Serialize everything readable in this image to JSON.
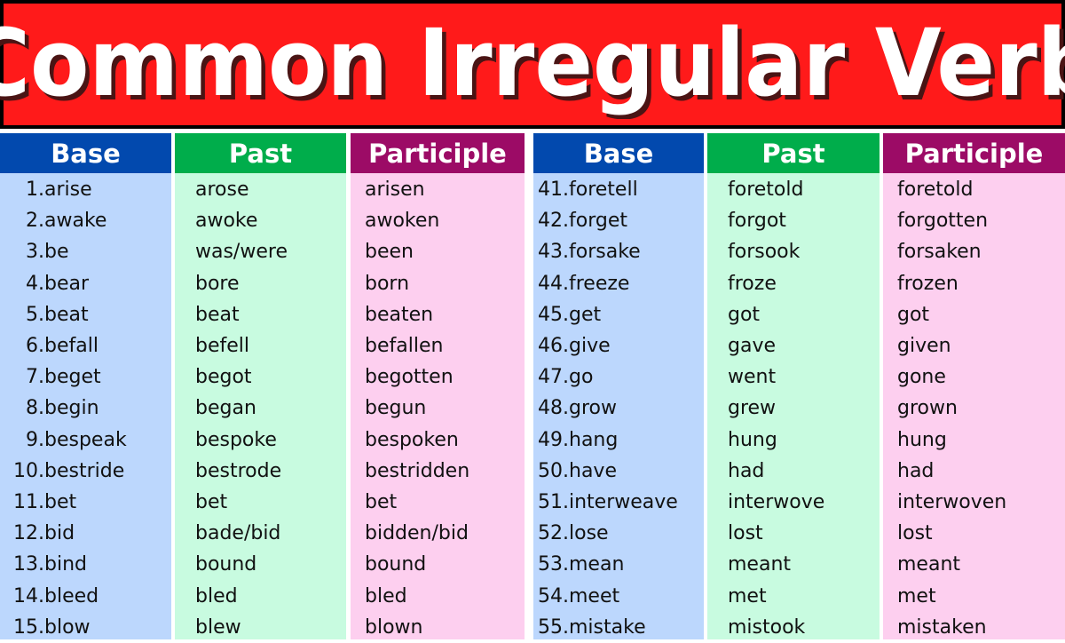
{
  "title": "Common Irregular Verb",
  "colors": {
    "title_bg": "#ff1a1a",
    "title_border": "#000000",
    "base_header": "#0249ae",
    "base_body": "#bcd7fd",
    "past_header": "#00ad4b",
    "past_body": "#c8fbe0",
    "participle_header": "#9c0b66",
    "participle_body": "#fdcfef"
  },
  "panels": [
    {
      "headers": {
        "base": "Base",
        "past": "Past",
        "participle": "Participle"
      },
      "rows": [
        {
          "num": "1.",
          "base": "arise",
          "past": "arose",
          "participle": "arisen"
        },
        {
          "num": "2.",
          "base": "awake",
          "past": "awoke",
          "participle": "awoken"
        },
        {
          "num": "3.",
          "base": "be",
          "past": "was/were",
          "participle": "been"
        },
        {
          "num": "4.",
          "base": "bear",
          "past": "bore",
          "participle": "born"
        },
        {
          "num": "5.",
          "base": "beat",
          "past": "beat",
          "participle": "beaten"
        },
        {
          "num": "6.",
          "base": "befall",
          "past": "befell",
          "participle": "befallen"
        },
        {
          "num": "7.",
          "base": "beget",
          "past": "begot",
          "participle": "begotten"
        },
        {
          "num": "8.",
          "base": "begin",
          "past": "began",
          "participle": "begun"
        },
        {
          "num": "9.",
          "base": "bespeak",
          "past": "bespoke",
          "participle": "bespoken"
        },
        {
          "num": "10.",
          "base": "bestride",
          "past": "bestrode",
          "participle": "bestridden"
        },
        {
          "num": "11.",
          "base": "bet",
          "past": "bet",
          "participle": "bet"
        },
        {
          "num": "12.",
          "base": "bid",
          "past": "bade/bid",
          "participle": "bidden/bid"
        },
        {
          "num": "13.",
          "base": "bind",
          "past": "bound",
          "participle": "bound"
        },
        {
          "num": "14.",
          "base": "bleed",
          "past": "bled",
          "participle": "bled"
        },
        {
          "num": "15.",
          "base": "blow",
          "past": "blew",
          "participle": "blown"
        }
      ]
    },
    {
      "headers": {
        "base": "Base",
        "past": "Past",
        "participle": "Participle"
      },
      "rows": [
        {
          "num": "41.",
          "base": "foretell",
          "past": "foretold",
          "participle": "foretold"
        },
        {
          "num": "42.",
          "base": "forget",
          "past": "forgot",
          "participle": "forgotten"
        },
        {
          "num": "43.",
          "base": "forsake",
          "past": "forsook",
          "participle": "forsaken"
        },
        {
          "num": "44.",
          "base": "freeze",
          "past": "froze",
          "participle": "frozen"
        },
        {
          "num": "45.",
          "base": "get",
          "past": "got",
          "participle": "got"
        },
        {
          "num": "46.",
          "base": "give",
          "past": "gave",
          "participle": "given"
        },
        {
          "num": "47.",
          "base": "go",
          "past": "went",
          "participle": "gone"
        },
        {
          "num": "48.",
          "base": "grow",
          "past": "grew",
          "participle": "grown"
        },
        {
          "num": "49.",
          "base": "hang",
          "past": "hung",
          "participle": "hung"
        },
        {
          "num": "50.",
          "base": "have",
          "past": "had",
          "participle": "had"
        },
        {
          "num": "51.",
          "base": "interweave",
          "past": "interwove",
          "participle": "interwoven"
        },
        {
          "num": "52.",
          "base": "lose",
          "past": "lost",
          "participle": "lost"
        },
        {
          "num": "53.",
          "base": "mean",
          "past": "meant",
          "participle": "meant"
        },
        {
          "num": "54.",
          "base": "meet",
          "past": "met",
          "participle": "met"
        },
        {
          "num": "55.",
          "base": "mistake",
          "past": "mistook",
          "participle": "mistaken"
        }
      ]
    }
  ]
}
